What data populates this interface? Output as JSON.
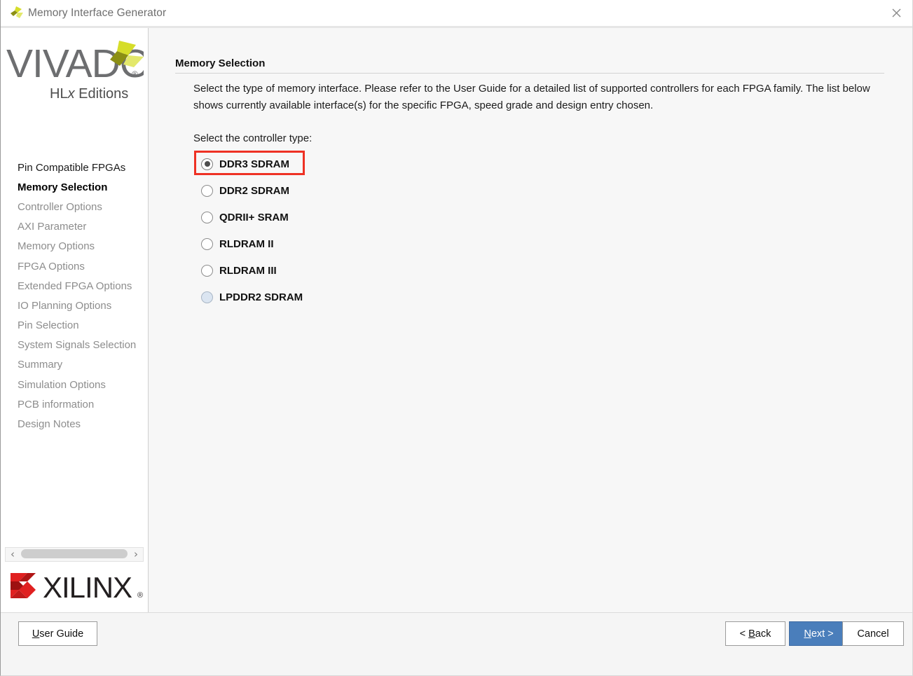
{
  "window": {
    "title": "Memory Interface Generator",
    "app_icon": "vivado-logo-icon",
    "close_icon": "close-icon"
  },
  "sidebar": {
    "logo_primary": "VIVADO",
    "logo_registered": "®",
    "logo_sub_pre": "HL",
    "logo_sub_italic": "x",
    "logo_sub_post": " Editions",
    "vendor_logo": "XILINX",
    "vendor_registered": "®",
    "scrollbar": {
      "left_arrow": "‹",
      "right_arrow": "›"
    },
    "items": [
      {
        "label": "Pin Compatible FPGAs",
        "state": "enabled"
      },
      {
        "label": "Memory Selection",
        "state": "current"
      },
      {
        "label": "Controller Options",
        "state": "disabled"
      },
      {
        "label": "AXI Parameter",
        "state": "disabled"
      },
      {
        "label": "Memory Options",
        "state": "disabled"
      },
      {
        "label": "FPGA Options",
        "state": "disabled"
      },
      {
        "label": "Extended FPGA Options",
        "state": "disabled"
      },
      {
        "label": "IO Planning Options",
        "state": "disabled"
      },
      {
        "label": "Pin Selection",
        "state": "disabled"
      },
      {
        "label": "System Signals Selection",
        "state": "disabled"
      },
      {
        "label": "Summary",
        "state": "disabled"
      },
      {
        "label": "Simulation Options",
        "state": "disabled"
      },
      {
        "label": "PCB information",
        "state": "disabled"
      },
      {
        "label": "Design Notes",
        "state": "disabled"
      }
    ]
  },
  "main": {
    "page_title": "Memory Selection",
    "description": "Select the type of memory interface. Please refer to the User Guide for a detailed list of supported controllers for each FPGA family. The list below shows currently available interface(s) for the specific FPGA, speed grade and design entry chosen.",
    "select_label": "Select the controller type:",
    "controller_options": [
      {
        "label": "DDR3 SDRAM",
        "checked": true,
        "hovered": false,
        "highlighted": true
      },
      {
        "label": "DDR2 SDRAM",
        "checked": false,
        "hovered": false,
        "highlighted": false
      },
      {
        "label": "QDRII+ SRAM",
        "checked": false,
        "hovered": false,
        "highlighted": false
      },
      {
        "label": "RLDRAM II",
        "checked": false,
        "hovered": false,
        "highlighted": false
      },
      {
        "label": "RLDRAM III",
        "checked": false,
        "hovered": false,
        "highlighted": false
      },
      {
        "label": "LPDDR2 SDRAM",
        "checked": false,
        "hovered": true,
        "highlighted": false
      }
    ],
    "highlight_color": "#ee3124"
  },
  "footer": {
    "user_guide": {
      "mnemonic": "U",
      "rest": "ser Guide"
    },
    "back": {
      "pre": "< ",
      "mnemonic": "B",
      "rest": "ack"
    },
    "next": {
      "mnemonic": "N",
      "rest": "ext >"
    },
    "cancel": {
      "label": "Cancel"
    }
  }
}
